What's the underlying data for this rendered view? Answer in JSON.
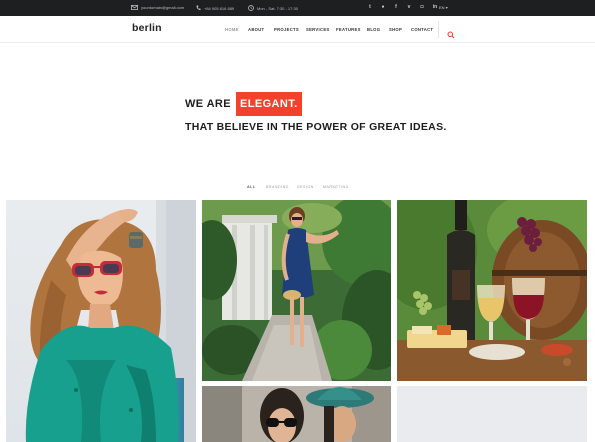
{
  "topbar": {
    "email": "yourdomain@gmail.com",
    "phone": "+84 905 816 889",
    "hours": "Mon - Sat: 7:30 - 17:30",
    "social_icons": [
      "twitter-icon",
      "dribbble-icon",
      "facebook-icon",
      "vimeo-icon",
      "instagram-icon",
      "linkedin-icon"
    ],
    "language": "EN"
  },
  "header": {
    "logo": "berlin",
    "nav": [
      "HOME",
      "ABOUT",
      "PROJECTS",
      "SERVICES",
      "FEATURES",
      "BLOG",
      "SHOP",
      "CONTACT"
    ],
    "active_nav": "HOME"
  },
  "hero": {
    "line1_prefix": "WE ARE",
    "line1_highlight": "ELEGANT.",
    "line2": "THAT BELIEVE IN THE POWER OF GREAT IDEAS."
  },
  "filters": {
    "items": [
      "ALL",
      "BRANDING",
      "DESIGN",
      "MARKETING"
    ],
    "active": "ALL"
  },
  "colors": {
    "accent": "#f2422b",
    "topbar": "#1e1f21",
    "text": "#1d1d1d"
  }
}
